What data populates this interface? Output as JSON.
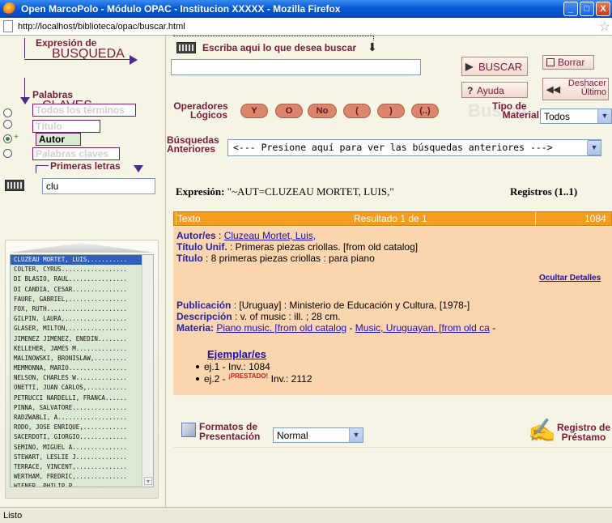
{
  "window": {
    "title": "Open MarcoPolo - Módulo OPAC - Institucion XXXXX - Mozilla Firefox",
    "minimize": "_",
    "maximize": "□",
    "close": "X"
  },
  "address": {
    "url": "http://localhost/biblioteca/opac/buscar.html"
  },
  "status": {
    "text": "Listo"
  },
  "left": {
    "expresion_small": "Expresión de",
    "expresion_big": "BUSQUEDA",
    "palabras_small": "Palabras",
    "palabras_big": "CLAVES",
    "fields": [
      {
        "label": "Todos los términos",
        "checked": false,
        "active": false
      },
      {
        "label": "Título",
        "checked": false,
        "active": false
      },
      {
        "label": "Autor",
        "checked": true,
        "active": true
      },
      {
        "label": "Palabras claves",
        "checked": false,
        "active": false
      }
    ],
    "primeras_letras": "Primeras letras",
    "letters_value": "clu",
    "list": [
      "CLUZEAU MORTET, LUIS,..........",
      "COLTER, CYRUS..................",
      "DI BLASIO, RAUL................",
      "DI CANDIA, CESAR...............",
      "FAURE, GABRIEL,................",
      "FOX, RUTH......................",
      "GILPIN, LAURA,.................",
      "GLASER, MILTON,................",
      "JIMENEZ JIMENEZ, ENEDIN........",
      "KELLEHER, JAMES M..............",
      "MALINOWSKI, BRONISLAW,.........",
      "MEMMONNA, MARIO................",
      "NELSON, CHARLES W..............",
      "ONETTI, JUAN CARLOS,...........",
      "PETRUCCI NARDELLI, FRANCA......",
      "PINNA, SALVATORE...............",
      "RADZWABLI, A...................",
      "RODO, JOSE ENRIQUE,............",
      "SACERDOTI, GIORGIO.............",
      "SEMINO, MIGUEL A...............",
      "STEWART, LESLIE J..............",
      "TERRACE, VINCENT,..............",
      "WERTHAM, FREDRIC,..............",
      "WIENER, PHILIP P..............."
    ]
  },
  "search": {
    "prompt": "Escriba aqui lo que desea buscar",
    "input_value": "",
    "buscar": "BUSCAR",
    "borrar": "Borrar",
    "ayuda": "Ayuda",
    "deshacer_1": "Deshacer",
    "deshacer_2": "Último",
    "operadores_1": "Operadores",
    "operadores_2": "Lógicos",
    "operators": [
      "Y",
      "O",
      "No",
      "(",
      ")",
      "(..)"
    ],
    "tipo_1": "Tipo de",
    "tipo_2": "Material",
    "tipo_value": "Todos",
    "busquedas_1": "Búsquedas",
    "busquedas_2": "Anteriores",
    "previous_placeholder": "<--- Presione aquí para ver las búsquedas anteriores --->",
    "watermark": "Buscar"
  },
  "results": {
    "expresion_label": "Expresión:",
    "expresion_value": "\"~AUT=CLUZEAU MORTET, LUIS,\"",
    "registros": "Registros (1..1)",
    "header": {
      "texto": "Texto",
      "resultado": "Resultado 1 de 1",
      "id": "1084"
    },
    "autor_label": "Autor/es",
    "autor_value": "Cluzeau Mortet, Luis,",
    "titulo_unif_label": "Título Unif.",
    "titulo_unif_value": "Primeras piezas criollas. [from old catalog]",
    "titulo_label": "Título",
    "titulo_value": "8 primeras piezas criollas : para piano",
    "ocultar": "Ocultar Detalles",
    "publicacion_label": "Publicación",
    "publicacion_value": "[Uruguay] : Ministerio de Educación y Cultura, [1978-]",
    "descripcion_label": "Descripción",
    "descripcion_value": "v. of music : ill. ; 28 cm.",
    "materia_label": "Materia:",
    "materia_1": "Piano music. [from old catalog",
    "materia_2": "Music, Uruguayan. [from old ca",
    "ejemplares": "Ejemplar/es",
    "ej1": "ej.1 - Inv.: 1084",
    "ej2_pre": "ej.2 -",
    "prestado": "¡PRESTADO!",
    "ej2_post": "Inv.: 2112"
  },
  "footer": {
    "formatos_1": "Formatos de",
    "formatos_2": "Presentación",
    "formato_value": "Normal",
    "registro_1": "Registro de",
    "registro_2": "Préstamo"
  },
  "colors": {
    "maroon": "#7a1a3c",
    "header_orange": "#f39c1d",
    "result_bg": "#fbd5ae",
    "page_bg": "#f6f4e4"
  }
}
